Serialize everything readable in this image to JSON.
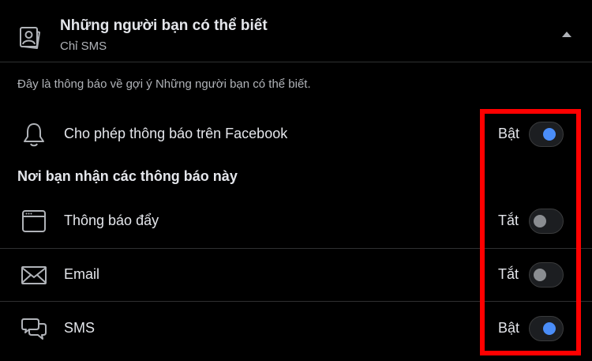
{
  "header": {
    "title": "Những người bạn có thể biết",
    "subtitle": "Chỉ SMS",
    "icon": "contact-card-icon",
    "collapse_icon": "caret-up-icon"
  },
  "description": "Đây là thông báo về gợi ý Những người bạn có thể biết.",
  "facebook_setting": {
    "label": "Cho phép thông báo trên Facebook",
    "status": "Bật",
    "enabled": true,
    "icon": "bell-icon"
  },
  "channels_heading": "Nơi bạn nhận các thông báo này",
  "channels": [
    {
      "label": "Thông báo đẩy",
      "status": "Tắt",
      "enabled": false,
      "icon": "browser-window-icon"
    },
    {
      "label": "Email",
      "status": "Tắt",
      "enabled": false,
      "icon": "envelope-icon"
    },
    {
      "label": "SMS",
      "status": "Bật",
      "enabled": true,
      "icon": "chat-bubbles-icon"
    }
  ],
  "colors": {
    "background": "#000000",
    "primary_text": "#e4e6eb",
    "secondary_text": "#b0b3b8",
    "toggle_on": "#4a8df8",
    "toggle_off": "#8a8d91",
    "highlight": "#ff0000"
  }
}
